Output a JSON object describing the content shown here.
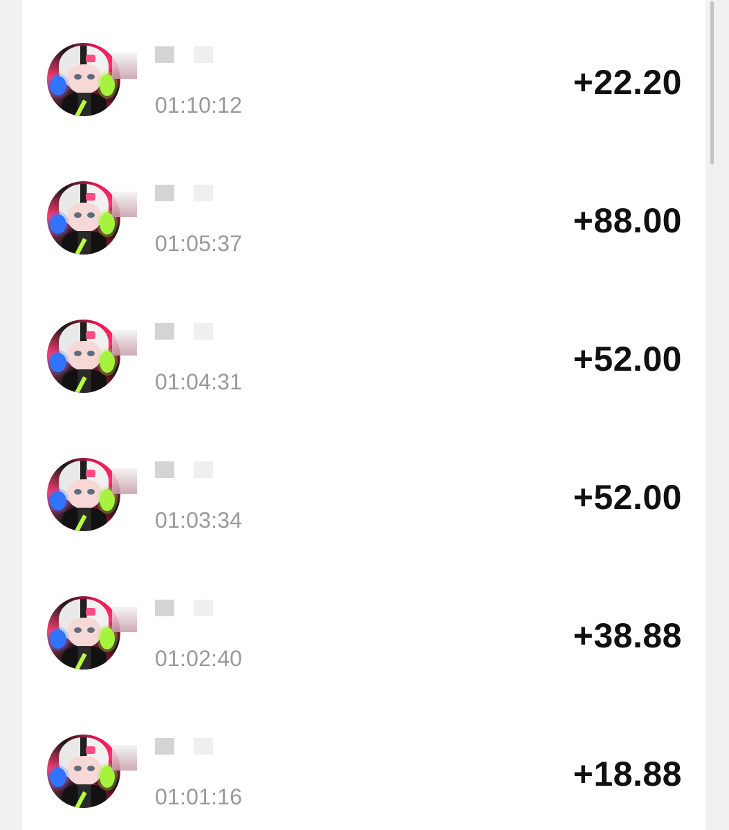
{
  "transactions": [
    {
      "time": "01:10:12",
      "amount": "+22.20"
    },
    {
      "time": "01:05:37",
      "amount": "+88.00"
    },
    {
      "time": "01:04:31",
      "amount": "+52.00"
    },
    {
      "time": "01:03:34",
      "amount": "+52.00"
    },
    {
      "time": "01:02:40",
      "amount": "+38.88"
    },
    {
      "time": "01:01:16",
      "amount": "+18.88"
    }
  ],
  "icons": {
    "avatar": "anime-avatar-icon",
    "redaction": "redacted-name-placeholder"
  },
  "colors": {
    "background": "#f1f1f1",
    "card": "#ffffff",
    "amount": "#111111",
    "time": "#999999",
    "scrollbar": "#c3c3c3"
  }
}
